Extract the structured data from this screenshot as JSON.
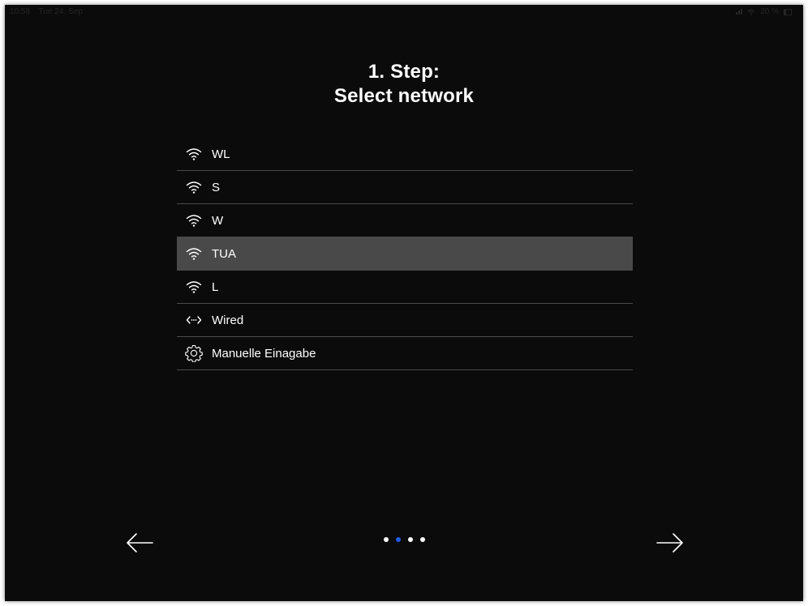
{
  "status_bar": {
    "time": "10:58",
    "date": "Tue 24. Sep",
    "battery": "20 %"
  },
  "title": {
    "line1": "1. Step:",
    "line2": "Select network"
  },
  "networks": [
    {
      "label": "WL",
      "icon": "wifi-icon",
      "selected": false
    },
    {
      "label": "S",
      "icon": "wifi-icon",
      "selected": false
    },
    {
      "label": "W",
      "icon": "wifi-icon",
      "selected": false
    },
    {
      "label": "TUA",
      "icon": "wifi-icon",
      "selected": true
    },
    {
      "label": "L",
      "icon": "wifi-icon",
      "selected": false
    },
    {
      "label": "Wired",
      "icon": "wired-connection-icon",
      "selected": false
    },
    {
      "label": "Manuelle Einagabe",
      "icon": "gear-icon",
      "selected": false
    }
  ],
  "pagination": {
    "total": 4,
    "current": 2
  },
  "colors": {
    "background": "#0b0b0b",
    "selected_row": "#494949",
    "divider": "#4a4a4a",
    "active_dot": "#1f5fe0",
    "text": "#ffffff"
  },
  "icons": {
    "back": "arrow-left-icon",
    "next": "arrow-right-icon"
  }
}
